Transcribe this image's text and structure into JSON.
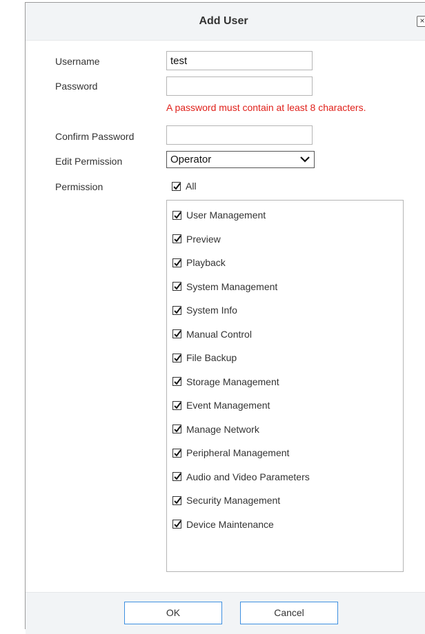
{
  "dialog": {
    "title": "Add User",
    "close_glyph": "×",
    "close_icon": "close-icon"
  },
  "form": {
    "username_label": "Username",
    "username_value": "test",
    "password_label": "Password",
    "password_value": "",
    "password_warning": "A password must contain at least 8 characters.",
    "confirm_label": "Confirm Password",
    "confirm_value": "",
    "edit_permission_label": "Edit Permission",
    "edit_permission_value": "Operator",
    "permission_label": "Permission",
    "all_label": "All",
    "all_checked": true
  },
  "permissions": [
    {
      "label": "User Management",
      "checked": true
    },
    {
      "label": "Preview",
      "checked": true
    },
    {
      "label": "Playback",
      "checked": true
    },
    {
      "label": "System Management",
      "checked": true
    },
    {
      "label": "System Info",
      "checked": true
    },
    {
      "label": "Manual Control",
      "checked": true
    },
    {
      "label": "File Backup",
      "checked": true
    },
    {
      "label": "Storage Management",
      "checked": true
    },
    {
      "label": "Event Management",
      "checked": true
    },
    {
      "label": "Manage Network",
      "checked": true
    },
    {
      "label": "Peripheral Management",
      "checked": true
    },
    {
      "label": "Audio and Video Parameters",
      "checked": true
    },
    {
      "label": "Security Management",
      "checked": true
    },
    {
      "label": "Device Maintenance",
      "checked": true
    }
  ],
  "footer": {
    "ok_label": "OK",
    "cancel_label": "Cancel"
  },
  "colors": {
    "warning": "#e0201a",
    "button_border": "#3d8fe0",
    "header_bg": "#f2f4f6"
  }
}
